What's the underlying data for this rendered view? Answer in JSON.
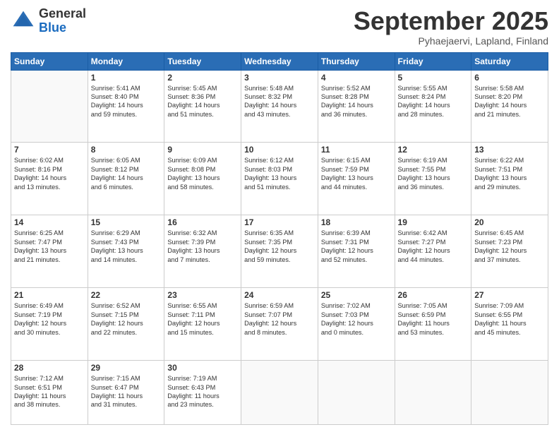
{
  "logo": {
    "general": "General",
    "blue": "Blue"
  },
  "header": {
    "title": "September 2025",
    "subtitle": "Pyhaejaervi, Lapland, Finland"
  },
  "days": [
    "Sunday",
    "Monday",
    "Tuesday",
    "Wednesday",
    "Thursday",
    "Friday",
    "Saturday"
  ],
  "weeks": [
    [
      {
        "day": "",
        "content": ""
      },
      {
        "day": "1",
        "content": "Sunrise: 5:41 AM\nSunset: 8:40 PM\nDaylight: 14 hours\nand 59 minutes."
      },
      {
        "day": "2",
        "content": "Sunrise: 5:45 AM\nSunset: 8:36 PM\nDaylight: 14 hours\nand 51 minutes."
      },
      {
        "day": "3",
        "content": "Sunrise: 5:48 AM\nSunset: 8:32 PM\nDaylight: 14 hours\nand 43 minutes."
      },
      {
        "day": "4",
        "content": "Sunrise: 5:52 AM\nSunset: 8:28 PM\nDaylight: 14 hours\nand 36 minutes."
      },
      {
        "day": "5",
        "content": "Sunrise: 5:55 AM\nSunset: 8:24 PM\nDaylight: 14 hours\nand 28 minutes."
      },
      {
        "day": "6",
        "content": "Sunrise: 5:58 AM\nSunset: 8:20 PM\nDaylight: 14 hours\nand 21 minutes."
      }
    ],
    [
      {
        "day": "7",
        "content": "Sunrise: 6:02 AM\nSunset: 8:16 PM\nDaylight: 14 hours\nand 13 minutes."
      },
      {
        "day": "8",
        "content": "Sunrise: 6:05 AM\nSunset: 8:12 PM\nDaylight: 14 hours\nand 6 minutes."
      },
      {
        "day": "9",
        "content": "Sunrise: 6:09 AM\nSunset: 8:08 PM\nDaylight: 13 hours\nand 58 minutes."
      },
      {
        "day": "10",
        "content": "Sunrise: 6:12 AM\nSunset: 8:03 PM\nDaylight: 13 hours\nand 51 minutes."
      },
      {
        "day": "11",
        "content": "Sunrise: 6:15 AM\nSunset: 7:59 PM\nDaylight: 13 hours\nand 44 minutes."
      },
      {
        "day": "12",
        "content": "Sunrise: 6:19 AM\nSunset: 7:55 PM\nDaylight: 13 hours\nand 36 minutes."
      },
      {
        "day": "13",
        "content": "Sunrise: 6:22 AM\nSunset: 7:51 PM\nDaylight: 13 hours\nand 29 minutes."
      }
    ],
    [
      {
        "day": "14",
        "content": "Sunrise: 6:25 AM\nSunset: 7:47 PM\nDaylight: 13 hours\nand 21 minutes."
      },
      {
        "day": "15",
        "content": "Sunrise: 6:29 AM\nSunset: 7:43 PM\nDaylight: 13 hours\nand 14 minutes."
      },
      {
        "day": "16",
        "content": "Sunrise: 6:32 AM\nSunset: 7:39 PM\nDaylight: 13 hours\nand 7 minutes."
      },
      {
        "day": "17",
        "content": "Sunrise: 6:35 AM\nSunset: 7:35 PM\nDaylight: 12 hours\nand 59 minutes."
      },
      {
        "day": "18",
        "content": "Sunrise: 6:39 AM\nSunset: 7:31 PM\nDaylight: 12 hours\nand 52 minutes."
      },
      {
        "day": "19",
        "content": "Sunrise: 6:42 AM\nSunset: 7:27 PM\nDaylight: 12 hours\nand 44 minutes."
      },
      {
        "day": "20",
        "content": "Sunrise: 6:45 AM\nSunset: 7:23 PM\nDaylight: 12 hours\nand 37 minutes."
      }
    ],
    [
      {
        "day": "21",
        "content": "Sunrise: 6:49 AM\nSunset: 7:19 PM\nDaylight: 12 hours\nand 30 minutes."
      },
      {
        "day": "22",
        "content": "Sunrise: 6:52 AM\nSunset: 7:15 PM\nDaylight: 12 hours\nand 22 minutes."
      },
      {
        "day": "23",
        "content": "Sunrise: 6:55 AM\nSunset: 7:11 PM\nDaylight: 12 hours\nand 15 minutes."
      },
      {
        "day": "24",
        "content": "Sunrise: 6:59 AM\nSunset: 7:07 PM\nDaylight: 12 hours\nand 8 minutes."
      },
      {
        "day": "25",
        "content": "Sunrise: 7:02 AM\nSunset: 7:03 PM\nDaylight: 12 hours\nand 0 minutes."
      },
      {
        "day": "26",
        "content": "Sunrise: 7:05 AM\nSunset: 6:59 PM\nDaylight: 11 hours\nand 53 minutes."
      },
      {
        "day": "27",
        "content": "Sunrise: 7:09 AM\nSunset: 6:55 PM\nDaylight: 11 hours\nand 45 minutes."
      }
    ],
    [
      {
        "day": "28",
        "content": "Sunrise: 7:12 AM\nSunset: 6:51 PM\nDaylight: 11 hours\nand 38 minutes."
      },
      {
        "day": "29",
        "content": "Sunrise: 7:15 AM\nSunset: 6:47 PM\nDaylight: 11 hours\nand 31 minutes."
      },
      {
        "day": "30",
        "content": "Sunrise: 7:19 AM\nSunset: 6:43 PM\nDaylight: 11 hours\nand 23 minutes."
      },
      {
        "day": "",
        "content": ""
      },
      {
        "day": "",
        "content": ""
      },
      {
        "day": "",
        "content": ""
      },
      {
        "day": "",
        "content": ""
      }
    ]
  ]
}
